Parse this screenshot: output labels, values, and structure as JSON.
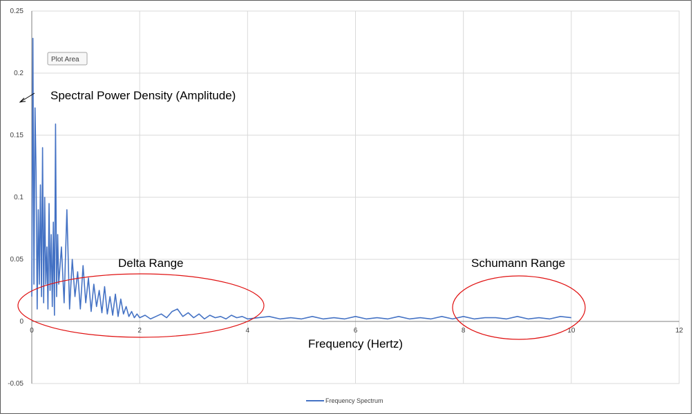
{
  "tooltip": {
    "label": "Plot Area"
  },
  "annotations": {
    "spd": "Spectral Power Density (Amplitude)",
    "delta": "Delta Range",
    "schumann": "Schumann Range",
    "xlabel": "Frequency (Hertz)"
  },
  "colors": {
    "series": "#4472C4",
    "ellipse": "#e01010",
    "grid": "#d9d9d9",
    "axis": "#7f7f7f"
  },
  "chart_data": {
    "type": "line",
    "title": "",
    "xlabel": "Frequency (Hertz)",
    "ylabel": "",
    "xlim": [
      0,
      12
    ],
    "ylim": [
      -0.05,
      0.25
    ],
    "x_ticks": [
      0,
      2,
      4,
      6,
      8,
      10,
      12
    ],
    "x_tick_labels": [
      "0",
      "2",
      "4",
      "6",
      "8",
      "10",
      "12"
    ],
    "y_ticks": [
      -0.05,
      0,
      0.05,
      0.1,
      0.15,
      0.2,
      0.25
    ],
    "y_tick_labels": [
      "-0.05",
      "0",
      "0.05",
      "0.1",
      "0.15",
      "0.2",
      "0.25"
    ],
    "grid": true,
    "legend": "bottom",
    "series": [
      {
        "name": "Frequency Spectrum",
        "x": [
          0,
          0.02,
          0.04,
          0.06,
          0.08,
          0.1,
          0.12,
          0.14,
          0.16,
          0.18,
          0.2,
          0.22,
          0.24,
          0.26,
          0.28,
          0.3,
          0.32,
          0.34,
          0.36,
          0.38,
          0.4,
          0.42,
          0.44,
          0.46,
          0.48,
          0.5,
          0.55,
          0.6,
          0.65,
          0.7,
          0.75,
          0.8,
          0.85,
          0.9,
          0.95,
          1.0,
          1.05,
          1.1,
          1.15,
          1.2,
          1.25,
          1.3,
          1.35,
          1.4,
          1.45,
          1.5,
          1.55,
          1.6,
          1.65,
          1.7,
          1.75,
          1.8,
          1.85,
          1.9,
          1.95,
          2.0,
          2.1,
          2.2,
          2.3,
          2.4,
          2.5,
          2.6,
          2.7,
          2.8,
          2.9,
          3.0,
          3.1,
          3.2,
          3.3,
          3.4,
          3.5,
          3.6,
          3.7,
          3.8,
          3.9,
          4.0,
          4.2,
          4.4,
          4.6,
          4.8,
          5.0,
          5.2,
          5.4,
          5.6,
          5.8,
          6.0,
          6.2,
          6.4,
          6.6,
          6.8,
          7.0,
          7.2,
          7.4,
          7.6,
          7.8,
          8.0,
          8.2,
          8.4,
          8.6,
          8.8,
          9.0,
          9.2,
          9.4,
          9.6,
          9.8,
          10.0
        ],
        "y": [
          0.02,
          0.228,
          0.03,
          0.172,
          0.12,
          0.01,
          0.09,
          0.03,
          0.11,
          0.02,
          0.14,
          0.015,
          0.1,
          0.03,
          0.06,
          0.01,
          0.095,
          0.025,
          0.07,
          0.012,
          0.08,
          0.005,
          0.159,
          0.02,
          0.07,
          0.03,
          0.06,
          0.015,
          0.09,
          0.01,
          0.05,
          0.02,
          0.04,
          0.01,
          0.045,
          0.015,
          0.035,
          0.008,
          0.03,
          0.012,
          0.025,
          0.007,
          0.028,
          0.006,
          0.02,
          0.005,
          0.022,
          0.004,
          0.018,
          0.006,
          0.012,
          0.004,
          0.008,
          0.003,
          0.006,
          0.003,
          0.005,
          0.002,
          0.004,
          0.006,
          0.003,
          0.008,
          0.01,
          0.004,
          0.007,
          0.003,
          0.006,
          0.002,
          0.005,
          0.003,
          0.004,
          0.002,
          0.005,
          0.003,
          0.004,
          0.002,
          0.003,
          0.004,
          0.002,
          0.003,
          0.002,
          0.004,
          0.002,
          0.003,
          0.002,
          0.004,
          0.002,
          0.003,
          0.002,
          0.004,
          0.002,
          0.003,
          0.002,
          0.004,
          0.002,
          0.004,
          0.002,
          0.003,
          0.003,
          0.002,
          0.004,
          0.002,
          0.003,
          0.002,
          0.004,
          0.003
        ]
      }
    ]
  }
}
